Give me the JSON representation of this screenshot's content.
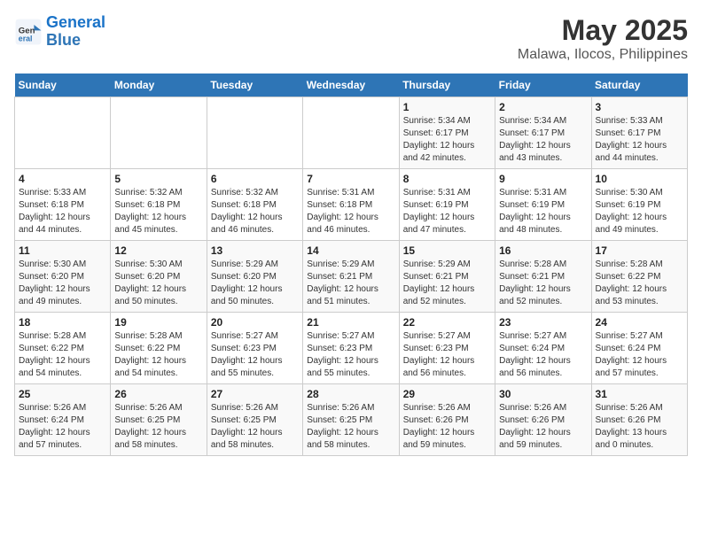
{
  "header": {
    "logo_line1": "General",
    "logo_line2": "Blue",
    "title": "May 2025",
    "subtitle": "Malawa, Ilocos, Philippines"
  },
  "days_of_week": [
    "Sunday",
    "Monday",
    "Tuesday",
    "Wednesday",
    "Thursday",
    "Friday",
    "Saturday"
  ],
  "weeks": [
    [
      {
        "day": "",
        "info": ""
      },
      {
        "day": "",
        "info": ""
      },
      {
        "day": "",
        "info": ""
      },
      {
        "day": "",
        "info": ""
      },
      {
        "day": "1",
        "info": "Sunrise: 5:34 AM\nSunset: 6:17 PM\nDaylight: 12 hours\nand 42 minutes."
      },
      {
        "day": "2",
        "info": "Sunrise: 5:34 AM\nSunset: 6:17 PM\nDaylight: 12 hours\nand 43 minutes."
      },
      {
        "day": "3",
        "info": "Sunrise: 5:33 AM\nSunset: 6:17 PM\nDaylight: 12 hours\nand 44 minutes."
      }
    ],
    [
      {
        "day": "4",
        "info": "Sunrise: 5:33 AM\nSunset: 6:18 PM\nDaylight: 12 hours\nand 44 minutes."
      },
      {
        "day": "5",
        "info": "Sunrise: 5:32 AM\nSunset: 6:18 PM\nDaylight: 12 hours\nand 45 minutes."
      },
      {
        "day": "6",
        "info": "Sunrise: 5:32 AM\nSunset: 6:18 PM\nDaylight: 12 hours\nand 46 minutes."
      },
      {
        "day": "7",
        "info": "Sunrise: 5:31 AM\nSunset: 6:18 PM\nDaylight: 12 hours\nand 46 minutes."
      },
      {
        "day": "8",
        "info": "Sunrise: 5:31 AM\nSunset: 6:19 PM\nDaylight: 12 hours\nand 47 minutes."
      },
      {
        "day": "9",
        "info": "Sunrise: 5:31 AM\nSunset: 6:19 PM\nDaylight: 12 hours\nand 48 minutes."
      },
      {
        "day": "10",
        "info": "Sunrise: 5:30 AM\nSunset: 6:19 PM\nDaylight: 12 hours\nand 49 minutes."
      }
    ],
    [
      {
        "day": "11",
        "info": "Sunrise: 5:30 AM\nSunset: 6:20 PM\nDaylight: 12 hours\nand 49 minutes."
      },
      {
        "day": "12",
        "info": "Sunrise: 5:30 AM\nSunset: 6:20 PM\nDaylight: 12 hours\nand 50 minutes."
      },
      {
        "day": "13",
        "info": "Sunrise: 5:29 AM\nSunset: 6:20 PM\nDaylight: 12 hours\nand 50 minutes."
      },
      {
        "day": "14",
        "info": "Sunrise: 5:29 AM\nSunset: 6:21 PM\nDaylight: 12 hours\nand 51 minutes."
      },
      {
        "day": "15",
        "info": "Sunrise: 5:29 AM\nSunset: 6:21 PM\nDaylight: 12 hours\nand 52 minutes."
      },
      {
        "day": "16",
        "info": "Sunrise: 5:28 AM\nSunset: 6:21 PM\nDaylight: 12 hours\nand 52 minutes."
      },
      {
        "day": "17",
        "info": "Sunrise: 5:28 AM\nSunset: 6:22 PM\nDaylight: 12 hours\nand 53 minutes."
      }
    ],
    [
      {
        "day": "18",
        "info": "Sunrise: 5:28 AM\nSunset: 6:22 PM\nDaylight: 12 hours\nand 54 minutes."
      },
      {
        "day": "19",
        "info": "Sunrise: 5:28 AM\nSunset: 6:22 PM\nDaylight: 12 hours\nand 54 minutes."
      },
      {
        "day": "20",
        "info": "Sunrise: 5:27 AM\nSunset: 6:23 PM\nDaylight: 12 hours\nand 55 minutes."
      },
      {
        "day": "21",
        "info": "Sunrise: 5:27 AM\nSunset: 6:23 PM\nDaylight: 12 hours\nand 55 minutes."
      },
      {
        "day": "22",
        "info": "Sunrise: 5:27 AM\nSunset: 6:23 PM\nDaylight: 12 hours\nand 56 minutes."
      },
      {
        "day": "23",
        "info": "Sunrise: 5:27 AM\nSunset: 6:24 PM\nDaylight: 12 hours\nand 56 minutes."
      },
      {
        "day": "24",
        "info": "Sunrise: 5:27 AM\nSunset: 6:24 PM\nDaylight: 12 hours\nand 57 minutes."
      }
    ],
    [
      {
        "day": "25",
        "info": "Sunrise: 5:26 AM\nSunset: 6:24 PM\nDaylight: 12 hours\nand 57 minutes."
      },
      {
        "day": "26",
        "info": "Sunrise: 5:26 AM\nSunset: 6:25 PM\nDaylight: 12 hours\nand 58 minutes."
      },
      {
        "day": "27",
        "info": "Sunrise: 5:26 AM\nSunset: 6:25 PM\nDaylight: 12 hours\nand 58 minutes."
      },
      {
        "day": "28",
        "info": "Sunrise: 5:26 AM\nSunset: 6:25 PM\nDaylight: 12 hours\nand 58 minutes."
      },
      {
        "day": "29",
        "info": "Sunrise: 5:26 AM\nSunset: 6:26 PM\nDaylight: 12 hours\nand 59 minutes."
      },
      {
        "day": "30",
        "info": "Sunrise: 5:26 AM\nSunset: 6:26 PM\nDaylight: 12 hours\nand 59 minutes."
      },
      {
        "day": "31",
        "info": "Sunrise: 5:26 AM\nSunset: 6:26 PM\nDaylight: 13 hours\nand 0 minutes."
      }
    ]
  ]
}
